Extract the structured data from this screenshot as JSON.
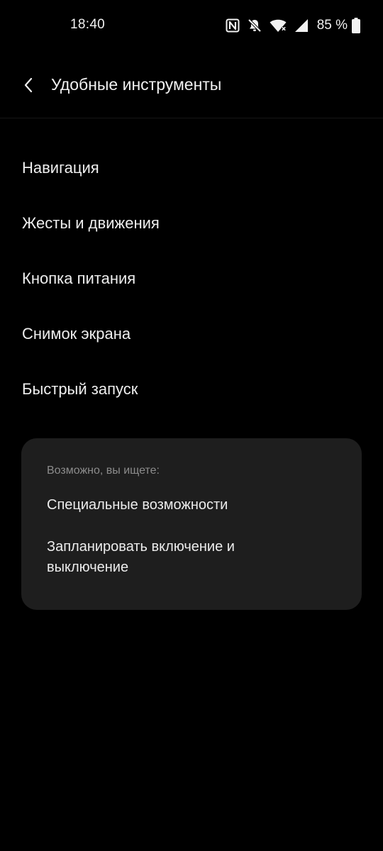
{
  "status_bar": {
    "time": "18:40",
    "battery_text": "85 %",
    "icons": [
      "nfc-icon",
      "bell-off-icon",
      "wifi-icon",
      "signal-icon",
      "battery-icon"
    ]
  },
  "header": {
    "title": "Удобные инструменты",
    "back_icon": "back-arrow-icon"
  },
  "menu": {
    "items": [
      {
        "label": "Навигация"
      },
      {
        "label": "Жесты и движения"
      },
      {
        "label": "Кнопка питания"
      },
      {
        "label": "Снимок экрана"
      },
      {
        "label": "Быстрый запуск"
      }
    ]
  },
  "suggestions": {
    "heading": "Возможно, вы ищете:",
    "items": [
      {
        "label": "Специальные возможности"
      },
      {
        "label": "Запланировать включение и выключение"
      }
    ]
  },
  "colors": {
    "background": "#000000",
    "card": "#1e1e1e",
    "text_primary": "#eeeeee",
    "text_secondary": "#8c8c8c"
  }
}
